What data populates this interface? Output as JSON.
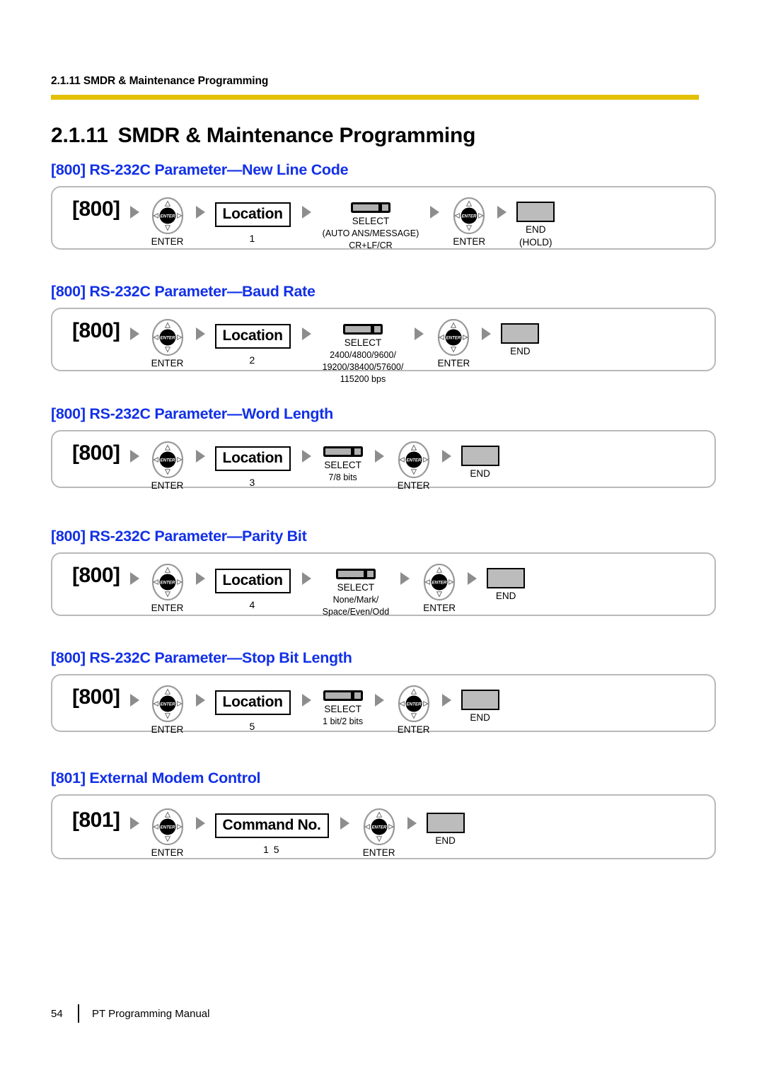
{
  "header": {
    "running_head": "2.1.11 SMDR & Maintenance Programming",
    "rule_color": "#e2c000"
  },
  "title": {
    "number": "2.1.11",
    "text": "SMDR & Maintenance Programming"
  },
  "theme": {
    "heading_blue": "#1230e8",
    "key_gray": "#bcbcbc",
    "arrow_gray": "#8d8d8d",
    "box_border_gray": "#b9b9b9"
  },
  "sections": [
    {
      "heading": "[800] RS-232C Parameter—New Line Code",
      "code": "[800]",
      "enter1_label": "ENTER",
      "value_box": "Location",
      "value_sub": "1",
      "select_label": "SELECT",
      "select_options_line1": "(AUTO ANS/MESSAGE)",
      "select_options_line2": "CR+LF/CR",
      "enter2_label": "ENTER",
      "end_label": "END",
      "end_sub": "(HOLD)"
    },
    {
      "heading": "[800] RS-232C Parameter—Baud Rate",
      "code": "[800]",
      "enter1_label": "ENTER",
      "value_box": "Location",
      "value_sub": "2",
      "select_label": "SELECT",
      "select_options_line1": "2400/4800/9600/",
      "select_options_line2": "19200/38400/57600/",
      "select_options_line3": "115200 bps",
      "enter2_label": "ENTER",
      "end_label": "END",
      "end_sub": ""
    },
    {
      "heading": "[800] RS-232C Parameter—Word Length",
      "code": "[800]",
      "enter1_label": "ENTER",
      "value_box": "Location",
      "value_sub": "3",
      "select_label": "SELECT",
      "select_options_line1": "7/8 bits",
      "enter2_label": "ENTER",
      "end_label": "END",
      "end_sub": ""
    },
    {
      "heading": "[800] RS-232C Parameter—Parity Bit",
      "code": "[800]",
      "enter1_label": "ENTER",
      "value_box": "Location",
      "value_sub": "4",
      "select_label": "SELECT",
      "select_options_line1": "None/Mark/",
      "select_options_line2": "Space/Even/Odd",
      "enter2_label": "ENTER",
      "end_label": "END",
      "end_sub": ""
    },
    {
      "heading": "[800] RS-232C Parameter—Stop Bit Length",
      "code": "[800]",
      "enter1_label": "ENTER",
      "value_box": "Location",
      "value_sub": "5",
      "select_label": "SELECT",
      "select_options_line1": "1 bit/2 bits",
      "enter2_label": "ENTER",
      "end_label": "END",
      "end_sub": ""
    },
    {
      "heading": "[801] External Modem Control",
      "code": "[801]",
      "enter1_label": "ENTER",
      "value_box": "Command No.",
      "value_sub": "1 5",
      "enter2_label": "ENTER",
      "end_label": "END",
      "end_sub": ""
    }
  ],
  "navkey": {
    "center_label": "ENTER"
  },
  "footer": {
    "page_number": "54",
    "manual_title": "PT Programming Manual"
  }
}
